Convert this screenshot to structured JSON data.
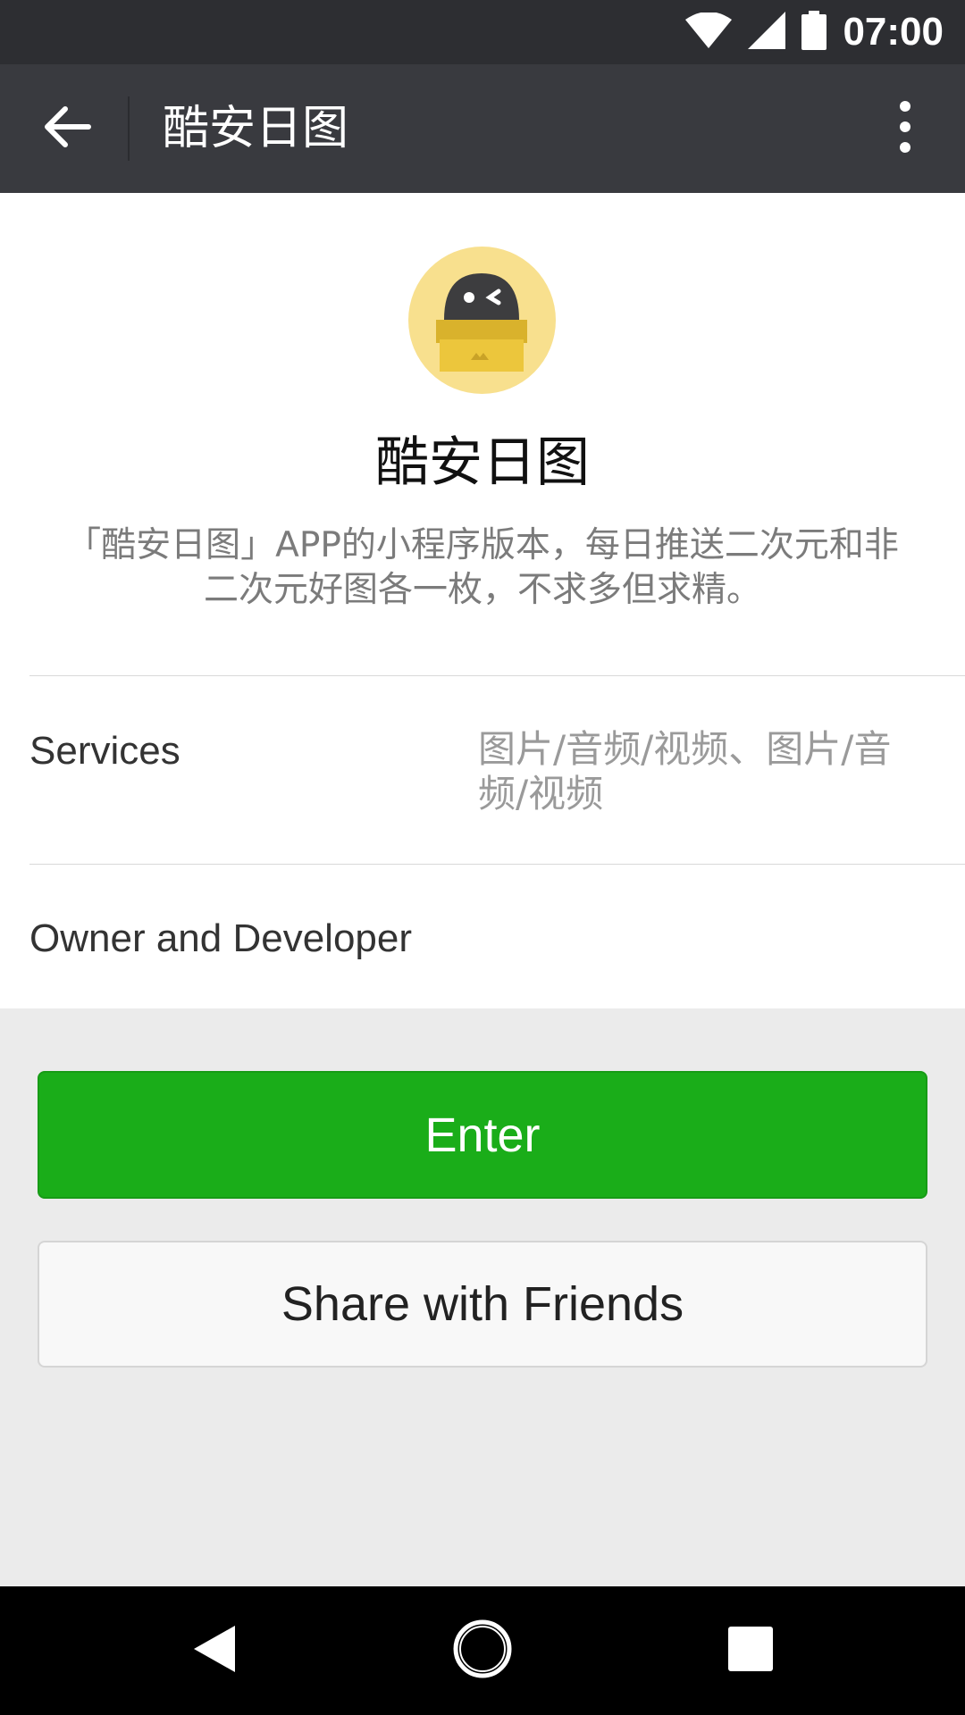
{
  "status_bar": {
    "time": "07:00",
    "icons": [
      "wifi-icon",
      "cellular-signal-icon",
      "battery-icon"
    ]
  },
  "action_bar": {
    "title": "酷安日图",
    "back_icon": "arrow-back-icon",
    "more_icon": "more-vertical-icon"
  },
  "app": {
    "name": "酷安日图",
    "description": "「酷安日图」APP的小程序版本，每日推送二次元和非二次元好图各一枚，不求多但求精。",
    "avatar_icon": "mascot-box-icon"
  },
  "info_rows": [
    {
      "label": "Services",
      "value": "图片/音频/视频、图片/音频/视频"
    },
    {
      "label": "Owner and Developer",
      "value": ""
    }
  ],
  "buttons": {
    "enter": "Enter",
    "share": "Share with Friends"
  },
  "nav_bar": {
    "icons": [
      "nav-back-icon",
      "nav-home-icon",
      "nav-recents-icon"
    ]
  },
  "colors": {
    "status_bar": "#2d2e32",
    "action_bar": "#393a3f",
    "primary_green": "#1aad19",
    "page_background": "#ebebeb",
    "avatar_yellow": "#f8e08e"
  }
}
